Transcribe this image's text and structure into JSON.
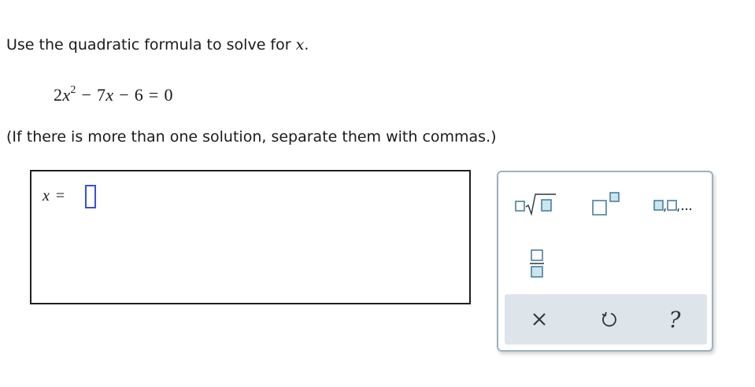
{
  "question": {
    "instruction_text": "Use the quadratic formula to solve for ",
    "instruction_variable": "x",
    "instruction_end": ".",
    "equation": {
      "coef_a": "2",
      "var1": "x",
      "exponent": "2",
      "minus1": "−",
      "coef_b": "7",
      "var2": "x",
      "minus2": "−",
      "constant": "6",
      "equals": "=",
      "rhs": "0"
    },
    "hint": "(If there is more than one solution, separate them with commas.)"
  },
  "answer": {
    "variable": "x",
    "equals": "=",
    "value": ""
  },
  "palette": {
    "buttons": [
      "nth-root",
      "superscript",
      "list",
      "fraction"
    ],
    "actions": {
      "clear_icon": "x-icon",
      "undo_icon": "undo-icon",
      "help_symbol": "?"
    },
    "colors": {
      "slot_fill": "#c9e6ef",
      "slot_stroke": "#4a7fa0",
      "border": "#9fb0c0",
      "action_bar": "#dde4ea",
      "cursor": "#3a4fd8"
    }
  }
}
